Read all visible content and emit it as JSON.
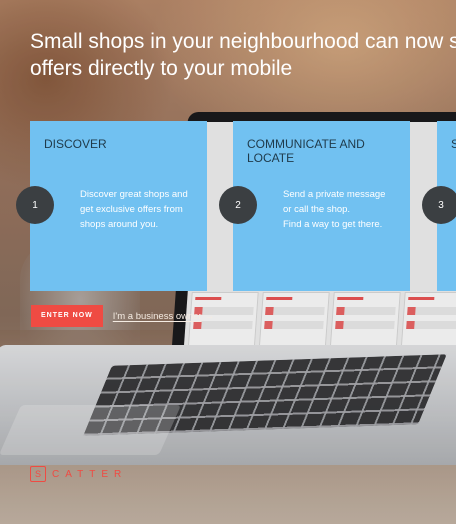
{
  "headline": {
    "line1": "Small shops in your neighbourhood can now send",
    "line2": "offers directly to your mobile"
  },
  "steps": [
    {
      "number": "1",
      "title": "DISCOVER",
      "text": "Discover great shops and get exclusive offers from shops around you."
    },
    {
      "number": "2",
      "title": "COMMUNICATE AND LOCATE",
      "text": "Send a private message or call the shop.\nFind a way to get there."
    },
    {
      "number": "3",
      "title": "S",
      "text": ""
    }
  ],
  "cta": {
    "enter_label": "ENTER NOW",
    "business_link": "I'm a business owner",
    "business_arrow": "→"
  },
  "logo": {
    "letter": "S",
    "wordmark": "CATTER"
  },
  "colors": {
    "card": "#71c1f1",
    "badge": "#3b3f42",
    "accent": "#ef4b43"
  }
}
